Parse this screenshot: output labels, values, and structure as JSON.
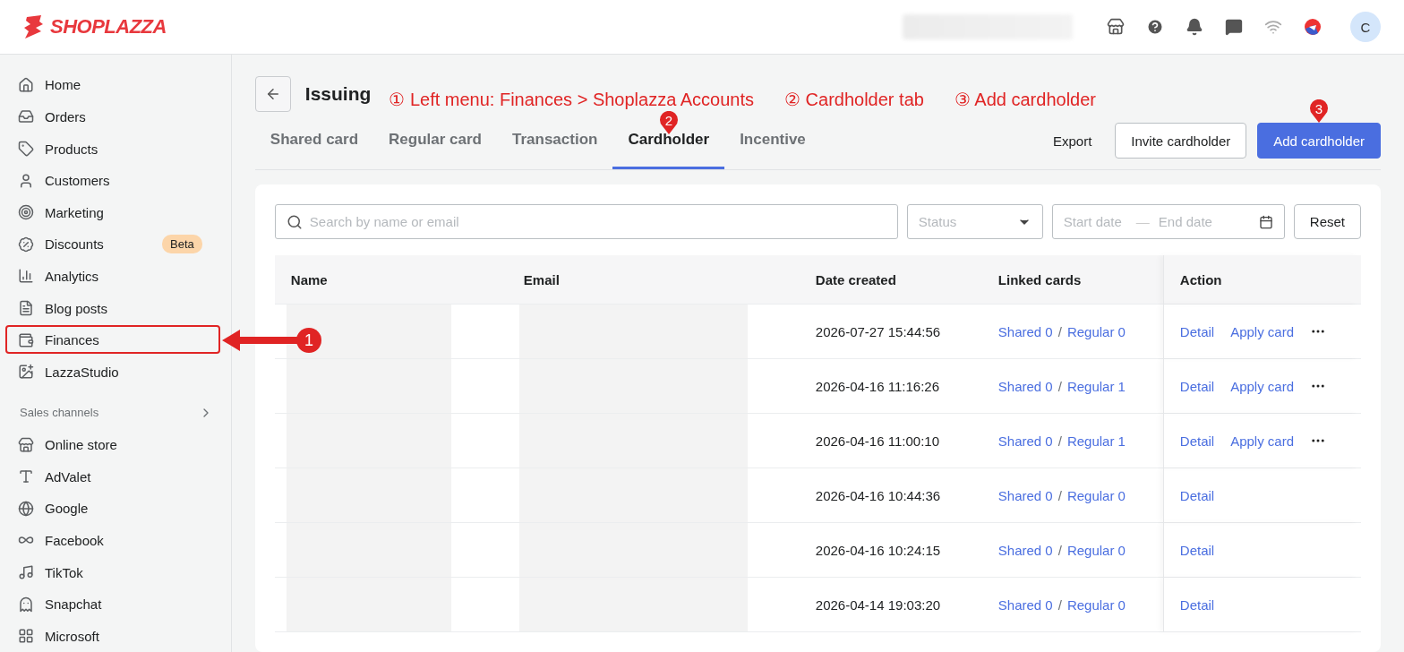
{
  "brand": "SHOPLAZZA",
  "header": {
    "avatar": "C"
  },
  "sidebar": {
    "items": [
      {
        "label": "Home",
        "annotated": false
      },
      {
        "label": "Orders",
        "annotated": false
      },
      {
        "label": "Products",
        "annotated": false
      },
      {
        "label": "Customers",
        "annotated": false
      },
      {
        "label": "Marketing",
        "annotated": false
      },
      {
        "label": "Discounts",
        "badge": "Beta",
        "annotated": false
      },
      {
        "label": "Analytics",
        "annotated": false
      },
      {
        "label": "Blog posts",
        "annotated": false
      },
      {
        "label": "Finances",
        "annotated": true
      },
      {
        "label": "LazzaStudio",
        "annotated": false
      }
    ],
    "section": "Sales channels",
    "channels": [
      {
        "label": "Online store"
      },
      {
        "label": "AdValet"
      },
      {
        "label": "Google"
      },
      {
        "label": "Facebook"
      },
      {
        "label": "TikTok"
      },
      {
        "label": "Snapchat"
      },
      {
        "label": "Microsoft"
      }
    ]
  },
  "page": {
    "title": "Issuing",
    "notes": [
      "① Left menu: Finances > Shoplazza Accounts",
      "② Cardholder tab",
      "③ Add cardholder"
    ]
  },
  "markers": [
    "1",
    "2",
    "3"
  ],
  "tabs": [
    {
      "label": "Shared card",
      "selected": false
    },
    {
      "label": "Regular card",
      "selected": false
    },
    {
      "label": "Transaction",
      "selected": false
    },
    {
      "label": "Cardholder",
      "selected": true
    },
    {
      "label": "Incentive",
      "selected": false
    }
  ],
  "actions": {
    "export": "Export",
    "invite": "Invite cardholder",
    "add": "Add cardholder"
  },
  "filters": {
    "search": {
      "placeholder": "Search by name or email"
    },
    "status": {
      "placeholder": "Status"
    },
    "start": {
      "placeholder": "Start date"
    },
    "separator": "—",
    "end": {
      "placeholder": "End date"
    },
    "reset": "Reset"
  },
  "table": {
    "columns": [
      "Name",
      "Email",
      "Date created",
      "Linked cards",
      "Action"
    ],
    "rows": [
      {
        "date": "2026-07-27 15:44:56",
        "shared": "Shared 0",
        "separator": "/",
        "regular": "Regular 0",
        "actions": [
          "Detail",
          "Apply card"
        ],
        "more": true
      },
      {
        "date": "2026-04-16 11:16:26",
        "shared": "Shared 0",
        "separator": "/",
        "regular": "Regular 1",
        "actions": [
          "Detail",
          "Apply card"
        ],
        "more": true
      },
      {
        "date": "2026-04-16 11:00:10",
        "shared": "Shared 0",
        "separator": "/",
        "regular": "Regular 1",
        "actions": [
          "Detail",
          "Apply card"
        ],
        "more": true
      },
      {
        "date": "2026-04-16 10:44:36",
        "shared": "Shared 0",
        "separator": "/",
        "regular": "Regular 0",
        "actions": [
          "Detail"
        ],
        "more": false
      },
      {
        "date": "2026-04-16 10:24:15",
        "shared": "Shared 0",
        "separator": "/",
        "regular": "Regular 0",
        "actions": [
          "Detail"
        ],
        "more": false
      },
      {
        "date": "2026-04-14 19:03:20",
        "shared": "Shared 0",
        "separator": "/",
        "regular": "Regular 0",
        "actions": [
          "Detail"
        ],
        "more": false
      }
    ]
  }
}
